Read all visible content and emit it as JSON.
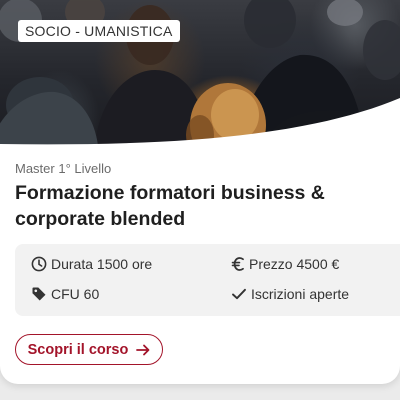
{
  "card": {
    "category_tag": "SOCIO - UMANISTICA",
    "level": "Master 1° Livello",
    "title": "Formazione formatori business & corporate blended",
    "details": {
      "duration": "Durata 1500 ore",
      "price": "Prezzo 4500 €",
      "credits": "CFU 60",
      "enrollment": "Iscrizioni aperte"
    },
    "cta_label": "Scopri il corso"
  },
  "icons": {
    "duration": "clock-icon",
    "price": "euro-icon",
    "credits": "tag-icon",
    "enrollment": "check-icon",
    "cta": "arrow-right-icon"
  },
  "colors": {
    "accent": "#a3142a",
    "details_background": "#f2f2f2",
    "title_text": "#1f1f1f"
  }
}
